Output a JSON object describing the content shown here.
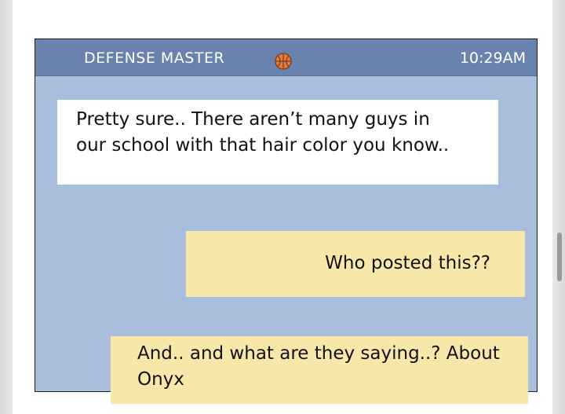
{
  "header": {
    "title": "DEFENSE MASTER",
    "time": "10:29AM",
    "icon": "basketball-icon",
    "colors": {
      "header_bg": "#6a82ae",
      "panel_bg": "#a9bedc",
      "ball": "#e07a3f"
    }
  },
  "messages": [
    {
      "type": "received",
      "lines": [
        "Pretty sure.. There aren’t many guys in",
        "our school with that hair color you know.."
      ],
      "color": "#ffffff"
    },
    {
      "type": "sent",
      "lines": [
        "Who posted this??"
      ],
      "color": "#f7e7a9"
    },
    {
      "type": "sent",
      "lines": [
        "And.. and what are they saying..? About",
        "Onyx"
      ],
      "color": "#f7e7a9"
    }
  ]
}
